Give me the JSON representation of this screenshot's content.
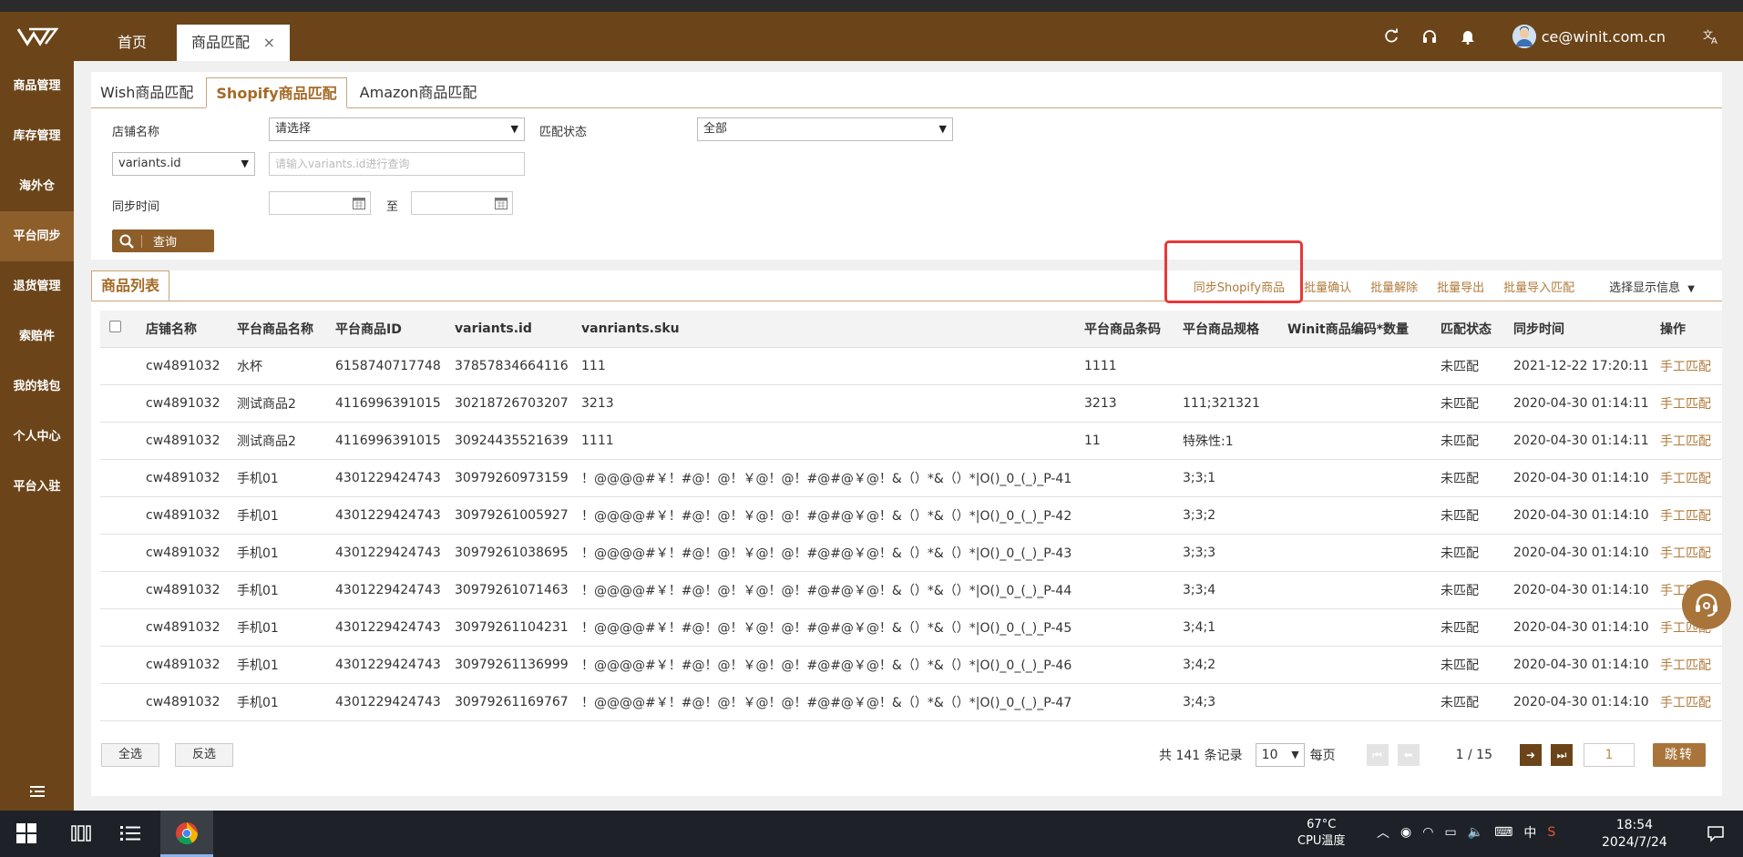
{
  "header": {
    "home_tab": "首页",
    "active_tab": "商品匹配",
    "close_glyph": "×",
    "user_email": "ce@winit.com.cn"
  },
  "sidebar": {
    "items": [
      {
        "label": "商品管理"
      },
      {
        "label": "库存管理"
      },
      {
        "label": "海外仓"
      },
      {
        "label": "平台同步"
      },
      {
        "label": "退货管理"
      },
      {
        "label": "索赔件"
      },
      {
        "label": "我的钱包"
      },
      {
        "label": "个人中心"
      },
      {
        "label": "平台入驻"
      }
    ],
    "active_index": 3
  },
  "sub_tabs": [
    {
      "label": "Wish商品匹配"
    },
    {
      "label": "Shopify商品匹配"
    },
    {
      "label": "Amazon商品匹配"
    }
  ],
  "filters": {
    "store_label": "店铺名称",
    "store_value": "请选择",
    "status_label": "匹配状态",
    "status_value": "全部",
    "field_select_value": "variants.id",
    "field_input_placeholder": "请输入variants.id进行查询",
    "sync_time_label": "同步时间",
    "to_label": "至",
    "search_button": "查询"
  },
  "list": {
    "tab_label": "商品列表",
    "actions": {
      "sync": "同步Shopify商品",
      "batch_confirm": "批量确认",
      "batch_release": "批量解除",
      "batch_export": "批量导出",
      "batch_import": "批量导入匹配",
      "display_info": "选择显示信息"
    },
    "columns": [
      "店铺名称",
      "平台商品名称",
      "平台商品ID",
      "variants.id",
      "vanriants.sku",
      "平台商品条码",
      "平台商品规格",
      "Winit商品编码*数量",
      "匹配状态",
      "同步时间",
      "操作"
    ],
    "rows": [
      {
        "store": "cw4891032",
        "name": "水杯",
        "pid": "6158740717748",
        "vid": "37857834664116",
        "sku": "111",
        "barcode": "1111",
        "spec": "",
        "winit": "",
        "status": "未匹配",
        "time": "2021-12-22 17:20:11",
        "op": "手工匹配"
      },
      {
        "store": "cw4891032",
        "name": "测试商品2",
        "pid": "4116996391015",
        "vid": "30218726703207",
        "sku": "3213",
        "barcode": "3213",
        "spec": "111;321321",
        "winit": "",
        "status": "未匹配",
        "time": "2020-04-30 01:14:11",
        "op": "手工匹配"
      },
      {
        "store": "cw4891032",
        "name": "测试商品2",
        "pid": "4116996391015",
        "vid": "30924435521639",
        "sku": "1111",
        "barcode": "11",
        "spec": "特殊性:1",
        "winit": "",
        "status": "未匹配",
        "time": "2020-04-30 01:14:11",
        "op": "手工匹配"
      },
      {
        "store": "cw4891032",
        "name": "手机01",
        "pid": "4301229424743",
        "vid": "30979260973159",
        "sku": "！@@@@#￥！#@！@！￥@！@！#@#@￥@！&（）*&（）*|O()_0_(_)_P-41",
        "barcode": "",
        "spec": "3;3;1",
        "winit": "",
        "status": "未匹配",
        "time": "2020-04-30 01:14:10",
        "op": "手工匹配"
      },
      {
        "store": "cw4891032",
        "name": "手机01",
        "pid": "4301229424743",
        "vid": "30979261005927",
        "sku": "！@@@@#￥！#@！@！￥@！@！#@#@￥@！&（）*&（）*|O()_0_(_)_P-42",
        "barcode": "",
        "spec": "3;3;2",
        "winit": "",
        "status": "未匹配",
        "time": "2020-04-30 01:14:10",
        "op": "手工匹配"
      },
      {
        "store": "cw4891032",
        "name": "手机01",
        "pid": "4301229424743",
        "vid": "30979261038695",
        "sku": "！@@@@#￥！#@！@！￥@！@！#@#@￥@！&（）*&（）*|O()_0_(_)_P-43",
        "barcode": "",
        "spec": "3;3;3",
        "winit": "",
        "status": "未匹配",
        "time": "2020-04-30 01:14:10",
        "op": "手工匹配"
      },
      {
        "store": "cw4891032",
        "name": "手机01",
        "pid": "4301229424743",
        "vid": "30979261071463",
        "sku": "！@@@@#￥！#@！@！￥@！@！#@#@￥@！&（）*&（）*|O()_0_(_)_P-44",
        "barcode": "",
        "spec": "3;3;4",
        "winit": "",
        "status": "未匹配",
        "time": "2020-04-30 01:14:10",
        "op": "手工匹配"
      },
      {
        "store": "cw4891032",
        "name": "手机01",
        "pid": "4301229424743",
        "vid": "30979261104231",
        "sku": "！@@@@#￥！#@！@！￥@！@！#@#@￥@！&（）*&（）*|O()_0_(_)_P-45",
        "barcode": "",
        "spec": "3;4;1",
        "winit": "",
        "status": "未匹配",
        "time": "2020-04-30 01:14:10",
        "op": "手工匹配"
      },
      {
        "store": "cw4891032",
        "name": "手机01",
        "pid": "4301229424743",
        "vid": "30979261136999",
        "sku": "！@@@@#￥！#@！@！￥@！@！#@#@￥@！&（）*&（）*|O()_0_(_)_P-46",
        "barcode": "",
        "spec": "3;4;2",
        "winit": "",
        "status": "未匹配",
        "time": "2020-04-30 01:14:10",
        "op": "手工匹配"
      },
      {
        "store": "cw4891032",
        "name": "手机01",
        "pid": "4301229424743",
        "vid": "30979261169767",
        "sku": "！@@@@#￥！#@！@！￥@！@！#@#@￥@！&（）*&（）*|O()_0_(_)_P-47",
        "barcode": "",
        "spec": "3;4;3",
        "winit": "",
        "status": "未匹配",
        "time": "2020-04-30 01:14:10",
        "op": "手工匹配"
      }
    ],
    "select_all": "全选",
    "invert_select": "反选"
  },
  "pager": {
    "total_text": "共 141 条记录",
    "page_size": "10",
    "per_page": "每页",
    "page_info": "1 / 15",
    "page_input": "1",
    "jump": "跳转"
  },
  "taskbar": {
    "temp": "67°C",
    "temp_label": "CPU温度",
    "ime": "中",
    "time": "18:54",
    "date": "2024/7/24"
  },
  "colors": {
    "brand_brown": "#6b4519",
    "accent_gold": "#b07b3c",
    "highlight_red": "#e63939"
  }
}
